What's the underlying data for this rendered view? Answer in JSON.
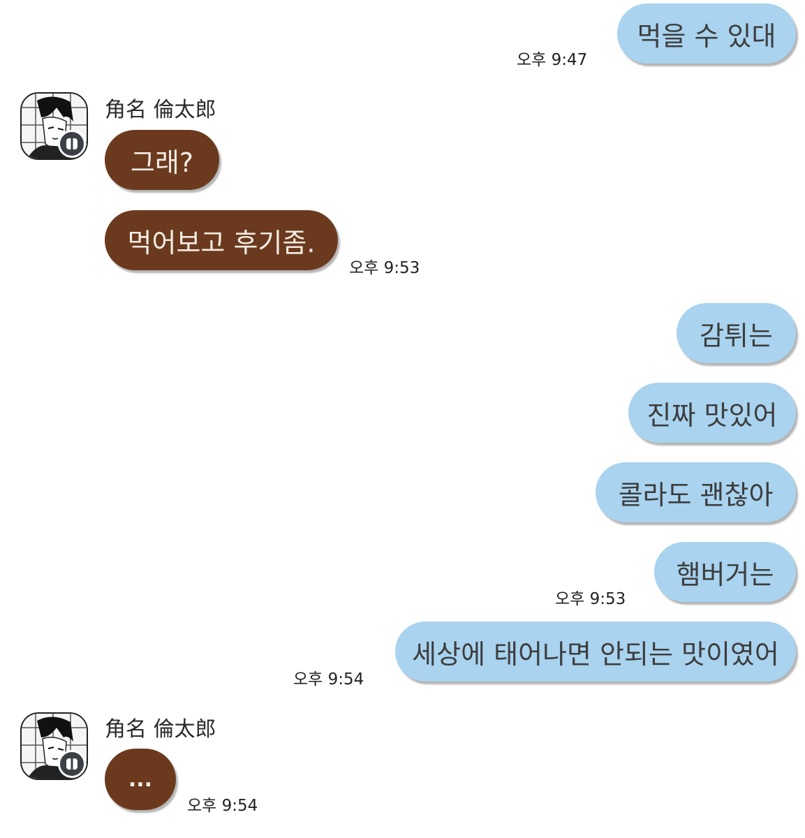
{
  "colors": {
    "my_bubble": "#a9d3ef",
    "their_bubble": "#6b3a1e",
    "background": "#ffffff"
  },
  "messages": [
    {
      "from": "me",
      "text": "먹을 수 있대",
      "time": "오후 9:47"
    },
    {
      "from": "them",
      "sender": "角名 倫太郎",
      "text": "그래?"
    },
    {
      "from": "them",
      "text": "먹어보고 후기좀.",
      "time": "오후 9:53"
    },
    {
      "from": "me",
      "text": "감튀는"
    },
    {
      "from": "me",
      "text": "진짜 맛있어"
    },
    {
      "from": "me",
      "text": "콜라도 괜찮아"
    },
    {
      "from": "me",
      "text": "햄버거는",
      "time": "오후 9:53"
    },
    {
      "from": "me",
      "text": "세상에 태어나면 안되는 맛이였어",
      "time": "오후 9:54"
    },
    {
      "from": "them",
      "sender": "角名 倫太郎",
      "text": "...",
      "time": "오후 9:54"
    }
  ],
  "avatar_icon": "profile-avatar-icon",
  "badge_icon": "chat-app-badge-icon"
}
